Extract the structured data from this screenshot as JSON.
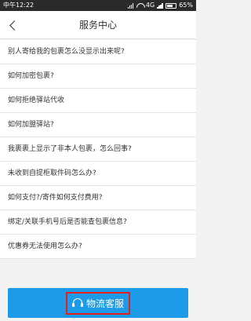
{
  "status_bar": {
    "carrier": "中午12:22",
    "network": "4G",
    "battery": "65%",
    "battery_level": 0.65
  },
  "nav": {
    "title": "服务中心",
    "back_icon": "chevron-left-icon"
  },
  "faq_items": [
    "别人寄给我的包裹怎么没显示出来呢?",
    "如何加密包裹?",
    "如何拒绝驿站代收",
    "如何加盟驿站?",
    "我裹裹上显示了非本人包裹，怎么回事?",
    "未收到自提柜取件码怎么办?",
    "如何支付?/寄件如何支付费用?",
    "绑定/关联手机号后是否能查包裹信息?",
    "优惠券无法使用怎么办?"
  ],
  "footer": {
    "service_button_label": "物流客服",
    "service_icon": "headset-icon",
    "accent_color": "#1e9be8",
    "highlight_color": "#e3201b"
  }
}
